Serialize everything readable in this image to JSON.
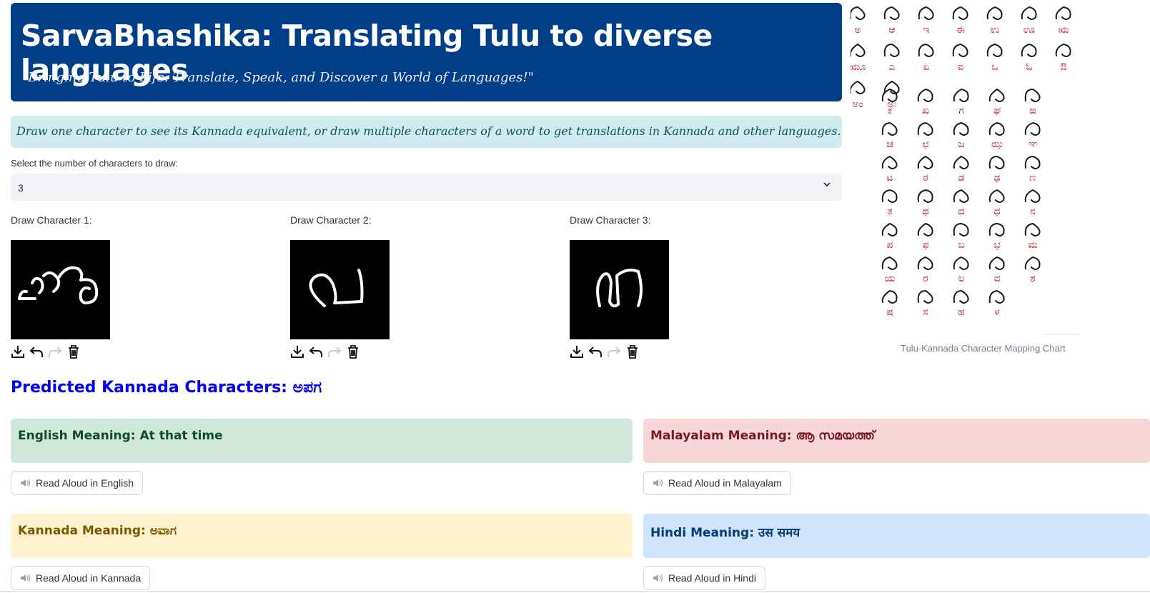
{
  "header": {
    "title": "SarvaBhashika: Translating Tulu to diverse languages",
    "tagline": "\"Bringing Tulu to Life: Translate, Speak, and Discover a World of Languages!\""
  },
  "info": {
    "text": "Draw one character to see its Kannada equivalent, or draw multiple characters of a word to get translations in Kannada and other languages."
  },
  "select": {
    "label": "Select the number of characters to draw:",
    "value": "3"
  },
  "draw": [
    {
      "label": "Draw Character 1:"
    },
    {
      "label": "Draw Character 2:"
    },
    {
      "label": "Draw Character 3:"
    }
  ],
  "chart": {
    "caption": "Tulu-Kannada Character Mapping Chart",
    "glyphs_top": [
      "ಅ",
      "ಆ",
      "ಇ",
      "ಈ",
      "ಉ",
      "ಊ",
      "ಋ",
      "ಋೂ",
      "ಎ",
      "ಏ",
      "ಐ",
      "ಒ",
      "ಓ",
      "ಔ",
      "ಅಂ",
      "ಅಃ"
    ],
    "glyphs_grid": [
      "ಕ",
      "ಖ",
      "ಗ",
      "ಘ",
      "ಙ",
      "ಚ",
      "ಛ",
      "ಜ",
      "ಝ",
      "ಞ",
      "ಟ",
      "ಠ",
      "ಡ",
      "ಢ",
      "ಣ",
      "ತ",
      "ಥ",
      "ದ",
      "ಧ",
      "ನ",
      "ಪ",
      "ಫ",
      "ಬ",
      "ಭ",
      "ಮ",
      "ಯ",
      "ರ",
      "ಲ",
      "ವ",
      "ಶ",
      "ಷ",
      "ಸ",
      "ಹ",
      "ಳ"
    ],
    "colors": {
      "tulu": "#1a1a1a",
      "kannada": "#b8283e"
    }
  },
  "prediction": {
    "text": "Predicted Kannada Characters: ಅಪಗ"
  },
  "meanings": {
    "english": {
      "text": "English Meaning: At that time",
      "button": "Read Aloud in English",
      "bg": "#d0e8dc",
      "color": "#0f4d2a"
    },
    "malayalam": {
      "text": "Malayalam Meaning: ആ സമയത്ത്",
      "button": "Read Aloud in Malayalam",
      "bg": "#f7d6d9",
      "color": "#7a1a22"
    },
    "kannada": {
      "text": "Kannada Meaning: ಅವಾಗ",
      "button": "Read Aloud in Kannada",
      "bg": "#fff2cc",
      "color": "#7a5a00"
    },
    "hindi": {
      "text": "Hindi Meaning: उस समय",
      "button": "Read Aloud in Hindi",
      "bg": "#cfe4ff",
      "color": "#083a75"
    }
  }
}
